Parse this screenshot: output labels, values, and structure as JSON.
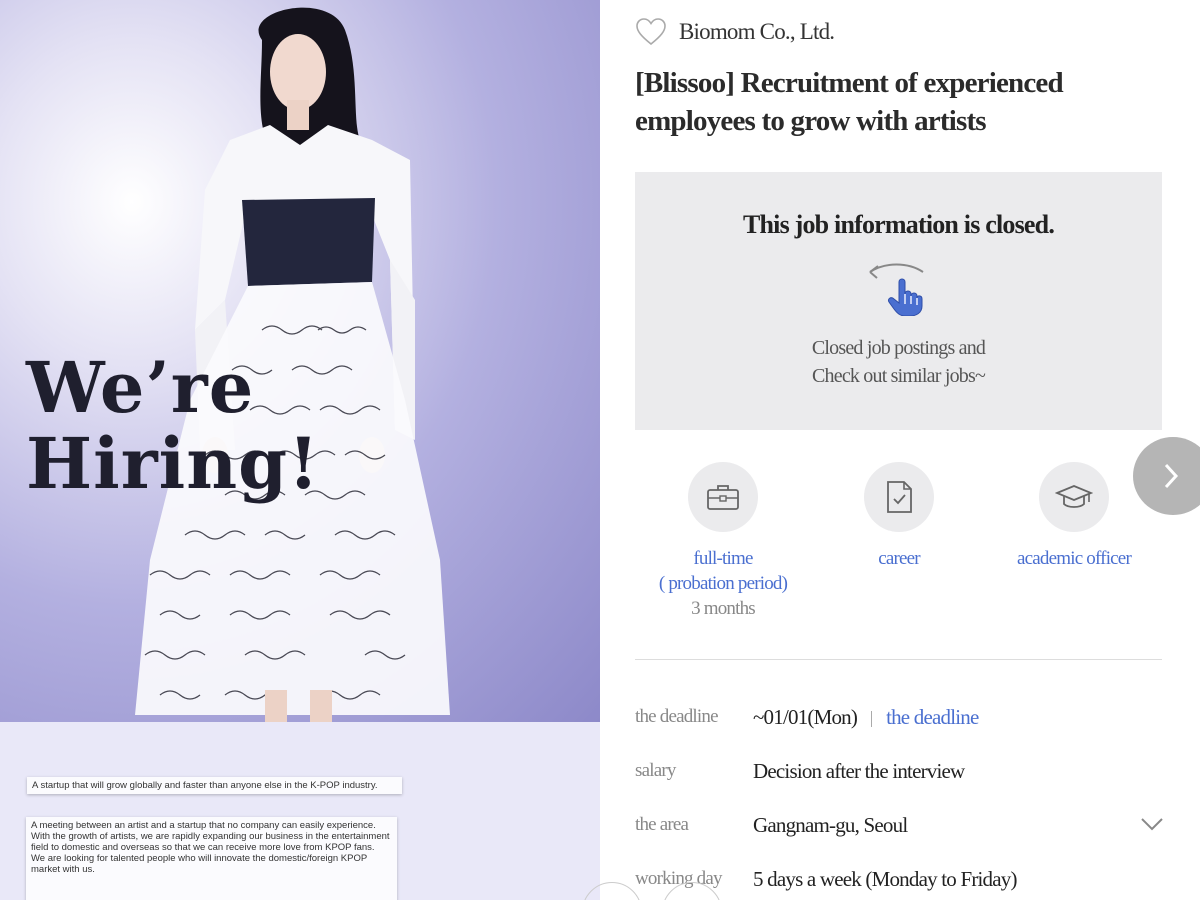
{
  "hero": {
    "line1": "We’re",
    "line2": "Hiring!"
  },
  "notes": {
    "tagline": "A startup that will grow globally and faster than anyone else in the K-POP industry.",
    "body": [
      "A meeting between an artist and a startup that no company can easily experience.",
      "With the growth of artists, we are rapidly expanding our business in the entertainment field to domestic and overseas so that we can receive more love from KPOP fans.",
      "We are looking for talented people who will innovate the domestic/foreign KPOP market with us."
    ]
  },
  "company": {
    "name": "Biomom Co., Ltd."
  },
  "job": {
    "title": "[Blissoo] Recruitment of experienced employees to grow with artists"
  },
  "closed": {
    "title": "This job information is closed.",
    "line1": "Closed job postings and",
    "line2": "Check out similar jobs~"
  },
  "features": [
    {
      "icon": "briefcase-icon",
      "line1": "full-time",
      "line2": "( probation period)",
      "line3": "3 months"
    },
    {
      "icon": "document-check-icon",
      "line1": "career"
    },
    {
      "icon": "graduation-cap-icon",
      "line1": "academic officer"
    }
  ],
  "details": {
    "deadline_label": "the deadline",
    "deadline_value": "~01/01(Mon)",
    "deadline_link": "the deadline",
    "salary_label": "salary",
    "salary_value": "Decision after the interview",
    "area_label": "the area",
    "area_value": "Gangnam-gu, Seoul",
    "working_label": "working day",
    "working_value": "5 days a week (Monday to Friday)"
  },
  "colors": {
    "accent": "#4a6fd0",
    "hero_bg": "#b3b0e0",
    "panel_gray": "#ebebed"
  }
}
